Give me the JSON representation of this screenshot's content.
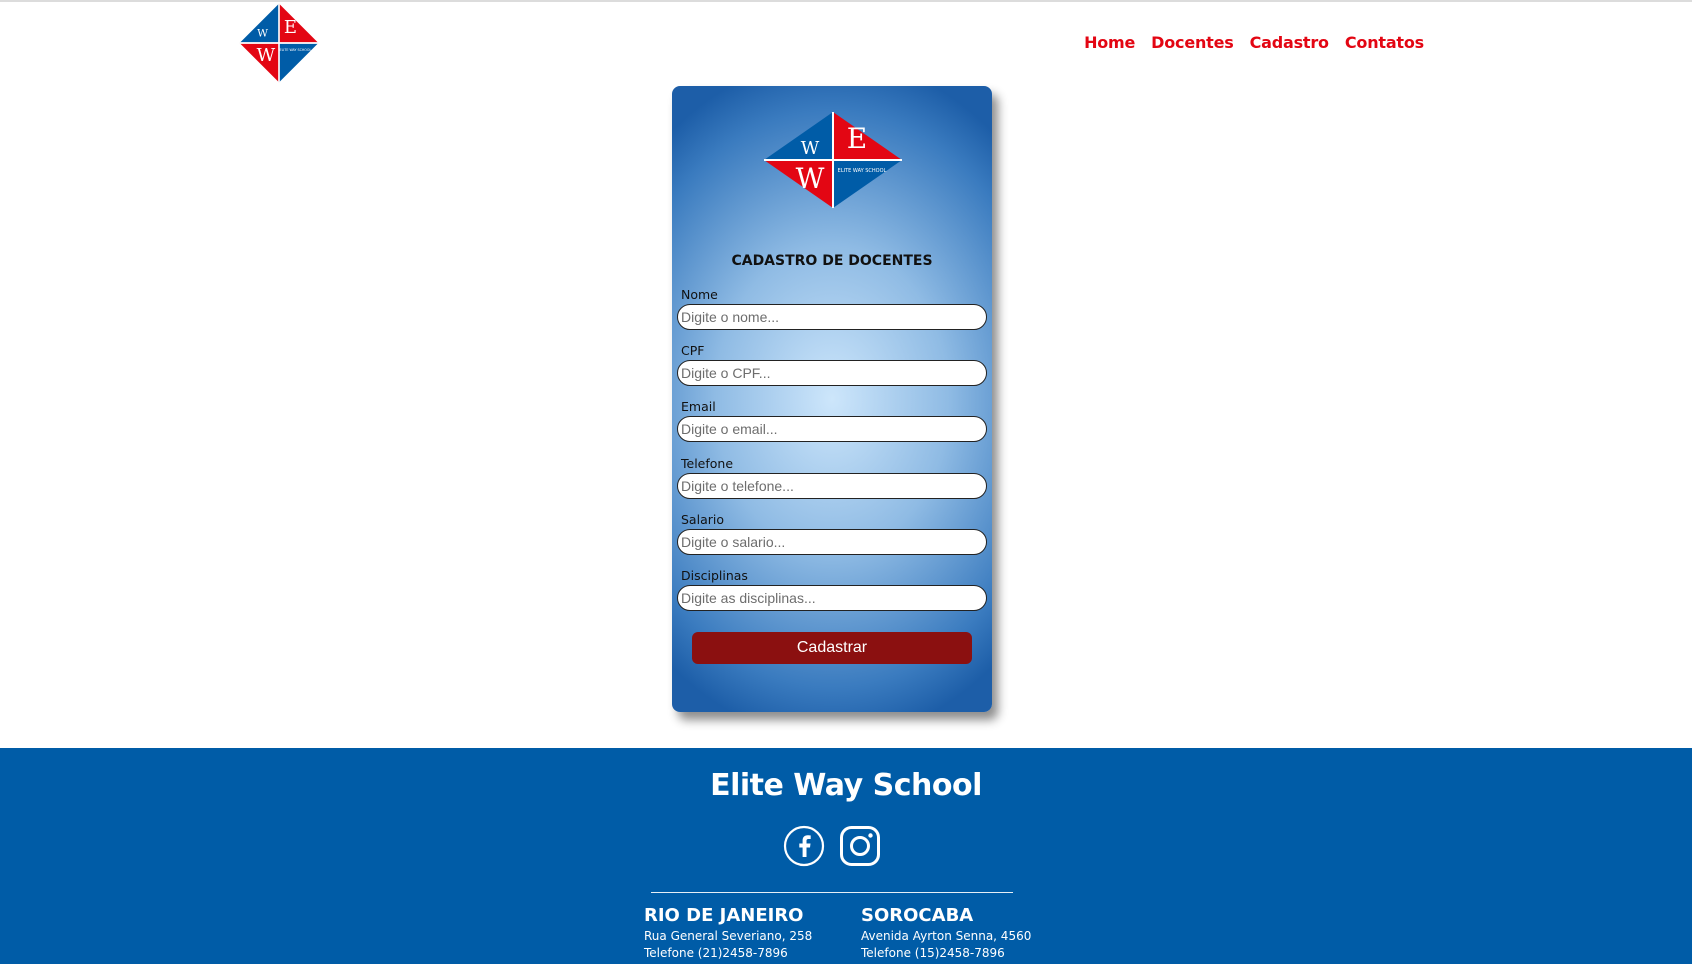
{
  "header": {
    "logo_letters": [
      "W",
      "E",
      "W"
    ],
    "logo_text": "ELITE WAY SCHOOL",
    "nav": [
      "Home",
      "Docentes",
      "Cadastro",
      "Contatos"
    ]
  },
  "form": {
    "title": "CADASTRO DE DOCENTES",
    "fields": [
      {
        "label": "Nome",
        "placeholder": "Digite o nome..."
      },
      {
        "label": "CPF",
        "placeholder": "Digite o CPF..."
      },
      {
        "label": "Email",
        "placeholder": "Digite o email..."
      },
      {
        "label": "Telefone",
        "placeholder": "Digite o telefone..."
      },
      {
        "label": "Salario",
        "placeholder": "Digite o salario..."
      },
      {
        "label": "Disciplinas",
        "placeholder": "Digite as disciplinas..."
      }
    ],
    "submit_label": "Cadastrar"
  },
  "footer": {
    "title": "Elite Way School",
    "social_icons": [
      "facebook-icon",
      "instagram-icon"
    ],
    "cities": [
      {
        "name": "RIO DE JANEIRO",
        "address": "Rua General Severiano, 258",
        "phone": "Telefone (21)2458-7896"
      },
      {
        "name": "SOROCABA",
        "address": "Avenida Ayrton Senna, 4560",
        "phone": "Telefone (15)2458-7896"
      }
    ]
  },
  "colors": {
    "nav_red": "#e30613",
    "logo_blue": "#005ca7",
    "logo_red": "#e30613",
    "button": "#8b1010",
    "footer_bg": "#005ca7"
  }
}
